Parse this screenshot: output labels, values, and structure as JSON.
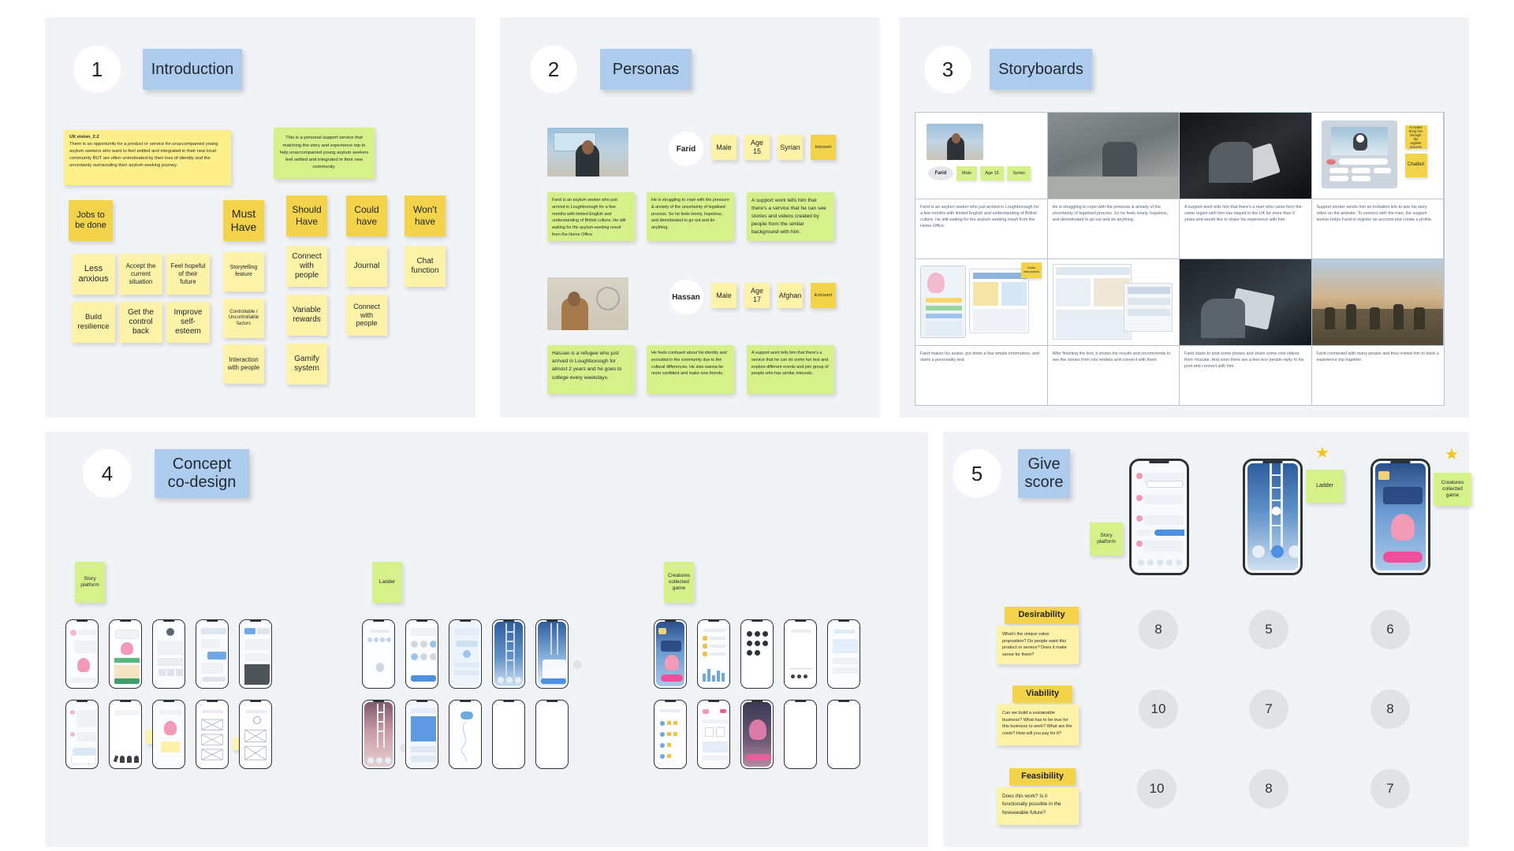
{
  "sections": [
    {
      "number": "1",
      "title": "Introduction"
    },
    {
      "number": "2",
      "title": "Personas"
    },
    {
      "number": "3",
      "title": "Storyboards"
    },
    {
      "number": "4",
      "title": "Concept\nco-design"
    },
    {
      "number": "5",
      "title": "Give\nscore"
    }
  ],
  "introduction": {
    "vision_title": "UX vision_2.2",
    "vision_body": "There is an opportunity for a product or service for unaccompanied young asylum seekers who want to feel settled and integrated in their new local community BUT are often unmotivated by their loss of identity and the uncertainty surrounding their asylum-seeking journey.",
    "service_note": "This is a personal support service that matching the story and experience trip to help unaccompanied young asylum seekers feel settled and integrated in their new community.",
    "jobs_header": "Jobs to\nbe done",
    "jobs": [
      "Less anxious",
      "Accept the current situation",
      "Feel hopeful of their future",
      "Build resilience",
      "Get the control back",
      "Improve self-esteem"
    ],
    "moscow": [
      {
        "header": "Must\nHave",
        "items": [
          "Storytelling feature",
          "Controllable / Uncontrollable factors",
          "Interaction with people"
        ]
      },
      {
        "header": "Should\nHave",
        "items": [
          "Connect with people",
          "Variable rewards",
          "Gamify system"
        ]
      },
      {
        "header": "Could\nhave",
        "items": [
          "Journal",
          "Connect with people"
        ]
      },
      {
        "header": "Won't\nhave",
        "items": [
          "Chat function"
        ]
      }
    ]
  },
  "personas": [
    {
      "name": "Farid",
      "tags": [
        "Male",
        "Age 15",
        "Syrian"
      ],
      "trait": "Introvert",
      "notes": [
        "Farid is an asylum seeker who just arrived in Loughborough for a few months with limited English and understanding of British culture. He still waiting for the asylum-seeking result from the Home Office.",
        "He is struggling to cope with the pressure & anxiety of the uncertainty of legalised process. So he feels lonely, hopeless, and demotivated to go out and do anything.",
        "A support work tells him that there's a service that he can see stories and videos created by people from the similar background with him."
      ]
    },
    {
      "name": "Hassan",
      "tags": [
        "Male",
        "Age 17",
        "Afghan"
      ],
      "trait": "Extrovert",
      "notes": [
        "Hassan is a refugee who just arrived in Loughborough for almost 2 years and he goes to college every weekdays.",
        "He feels confused about his identity and excluded in the community due to the cultural differences. He also wanna be more confident and make new friends.",
        "A support work tells him that there's a service that he can do some fun test and explore different events and join group of people who has similar interests."
      ]
    }
  ],
  "storyboard": {
    "persona_chip": "Farid",
    "persona_tags": [
      "Male",
      "Age 15",
      "Syrian"
    ],
    "chatbot_notes": [
      "AI avatar bring him through the register process",
      "Chatbot"
    ],
    "guide_note": "Guide instructions",
    "captions_row1": [
      "Farid is an asylum seeker who just arrived in Loughborough for a few months with limited English and understanding of British culture. He still waiting for the asylum-seeking result from the Home Office.",
      "He is struggling to cope with the pressure & anxiety of the uncertainty of legalised process. So he feels lonely, hopeless, and demotivated to go out and do anything.",
      "A support work tells him that there's a man who came from the same region with him has stayed in the UK for more than 5 years and would like to share his experience with him.",
      "Support worker sends him an invitation link to see his story video on the website. To connect with the man, the support worker helps Farid to register an account and create a profile."
    ],
    "captions_row2": [
      "Farid makes his avatar, put down a few simple information, and starts a personality test.",
      "After finishing the test, it shows the results and recommends to see the stories from role models and connect with them.",
      "Farid starts to post some photos and share some cool videos from Youtube. And soon there are a few nice people reply to his post and connect with him.",
      "Farid connected with many people and they invited him to book a experience trip together."
    ]
  },
  "codesign": {
    "concept_labels": [
      "Story platform",
      "Ladder",
      "Creatures collected game"
    ]
  },
  "scoring": {
    "concepts": [
      "Story platform",
      "Ladder",
      "Creatures collected game"
    ],
    "criteria": [
      {
        "label": "Desirability",
        "question": "What's the unique value proposition? Do people want this product or service? Does it make sense for them?",
        "scores": [
          "8",
          "5",
          "6"
        ]
      },
      {
        "label": "Viability",
        "question": "Can we build a sustainable business? What has to be true for this business to work? What are the costs? How will you pay for it?",
        "scores": [
          "10",
          "7",
          "8"
        ]
      },
      {
        "label": "Feasibility",
        "question": "Does this work? Is it functionally possible in the foreseeable future?",
        "scores": [
          "10",
          "8",
          "7"
        ]
      }
    ]
  },
  "colors": {
    "board_bg": "#f1f3f6",
    "title_blue": "#aeccee",
    "note_yellow": "#fdf08a",
    "note_light_yellow": "#fcf3a8",
    "note_dark_yellow": "#f3d34a",
    "note_green": "#d6f08a",
    "score_circle": "#e0e2e4",
    "star": "#f5c518"
  }
}
